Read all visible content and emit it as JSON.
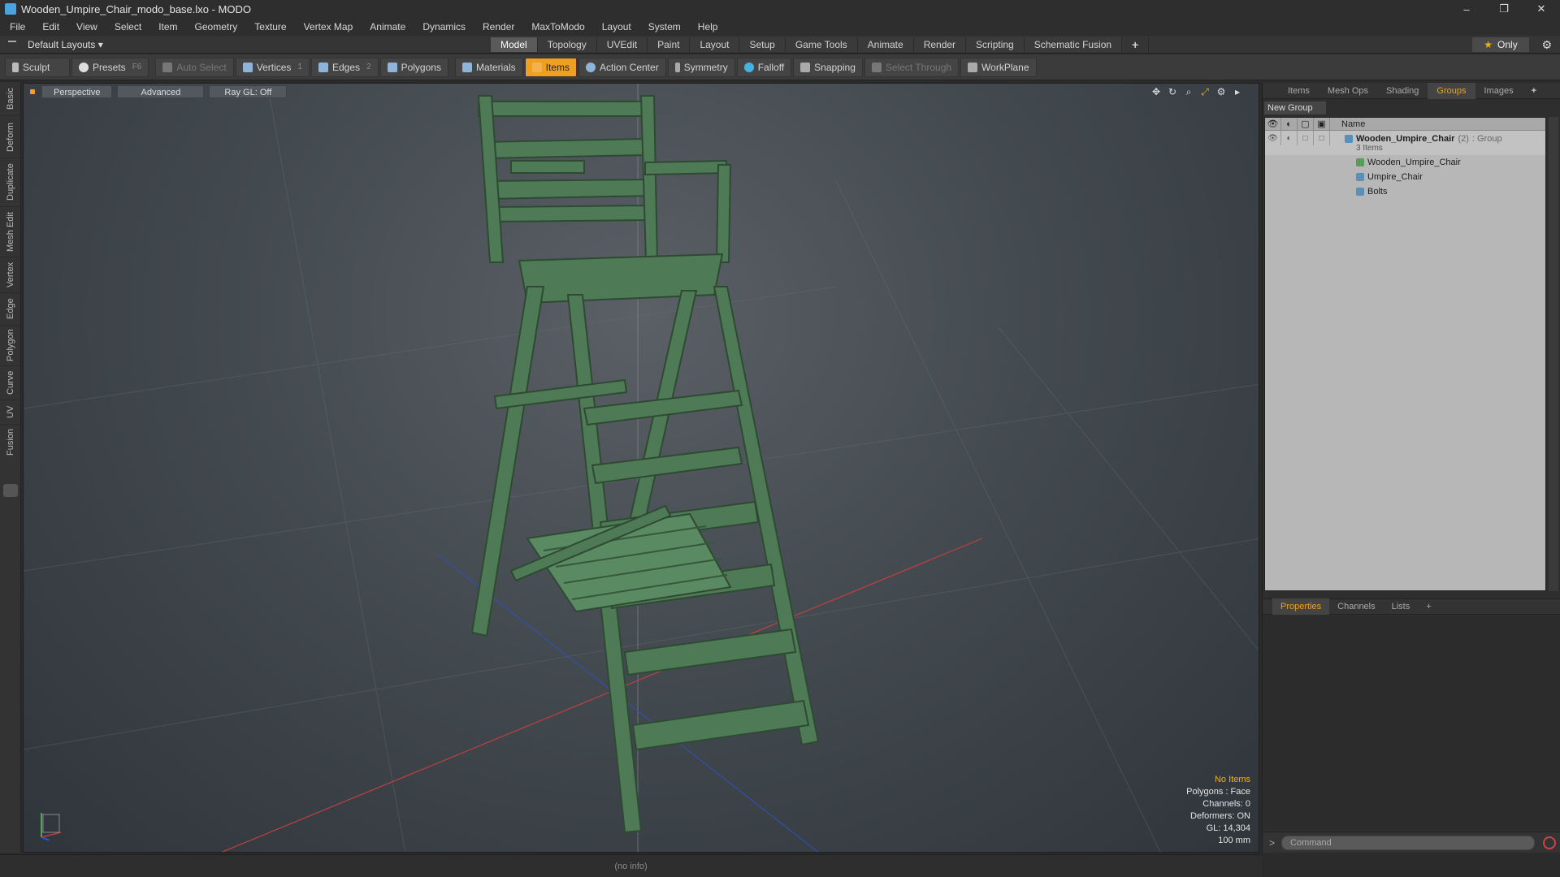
{
  "window": {
    "title": "Wooden_Umpire_Chair_modo_base.lxo - MODO",
    "controls": [
      "–",
      "❐",
      "✕"
    ]
  },
  "menu": [
    "File",
    "Edit",
    "View",
    "Select",
    "Item",
    "Geometry",
    "Texture",
    "Vertex Map",
    "Animate",
    "Dynamics",
    "Render",
    "MaxToModo",
    "Layout",
    "System",
    "Help"
  ],
  "layouts": {
    "selector": "Default Layouts ▾",
    "tabs": [
      "Model",
      "Topology",
      "UVEdit",
      "Paint",
      "Layout",
      "Setup",
      "Game Tools",
      "Animate",
      "Render",
      "Scripting",
      "Schematic Fusion"
    ],
    "active_tab": "Model",
    "plus": "+",
    "only": "Only"
  },
  "toolbar": {
    "sculpt": "Sculpt",
    "presets": "Presets",
    "presets_key": "F6",
    "auto_select": "Auto Select",
    "vertices": "Vertices",
    "vertices_key": "1",
    "edges": "Edges",
    "edges_key": "2",
    "polygons": "Polygons",
    "materials": "Materials",
    "items": "Items",
    "action_center": "Action Center",
    "symmetry": "Symmetry",
    "falloff": "Falloff",
    "snapping": "Snapping",
    "select_through": "Select Through",
    "workplane": "WorkPlane"
  },
  "left_tabs": [
    "Basic",
    "Deform",
    "Duplicate",
    "Mesh Edit",
    "Vertex",
    "Edge",
    "Polygon",
    "Curve",
    "UV",
    "Fusion"
  ],
  "viewport": {
    "view": "Perspective",
    "advanced": "Advanced",
    "raygl": "Ray GL: Off",
    "info": {
      "selection": "No Items",
      "polygons": "Polygons : Face",
      "channels": "Channels: 0",
      "deformers": "Deformers: ON",
      "gl": "GL: 14,304",
      "scale": "100 mm"
    }
  },
  "right_panel": {
    "tabs": [
      "Items",
      "Mesh Ops",
      "Shading",
      "Groups",
      "Images"
    ],
    "active_tab": "Groups",
    "new_group": "New Group",
    "column_name": "Name",
    "group": {
      "name": "Wooden_Umpire_Chair",
      "count": "(2)",
      "type": ": Group",
      "items_count": "3 Items",
      "children": [
        "Wooden_Umpire_Chair",
        "Umpire_Chair",
        "Bolts"
      ]
    },
    "lower_tabs": [
      "Properties",
      "Channels",
      "Lists"
    ],
    "lower_active": "Properties",
    "command_placeholder": "Command"
  },
  "status": "(no info)",
  "colors": {
    "accent": "#f0a020",
    "chair": "#4e7a55"
  }
}
